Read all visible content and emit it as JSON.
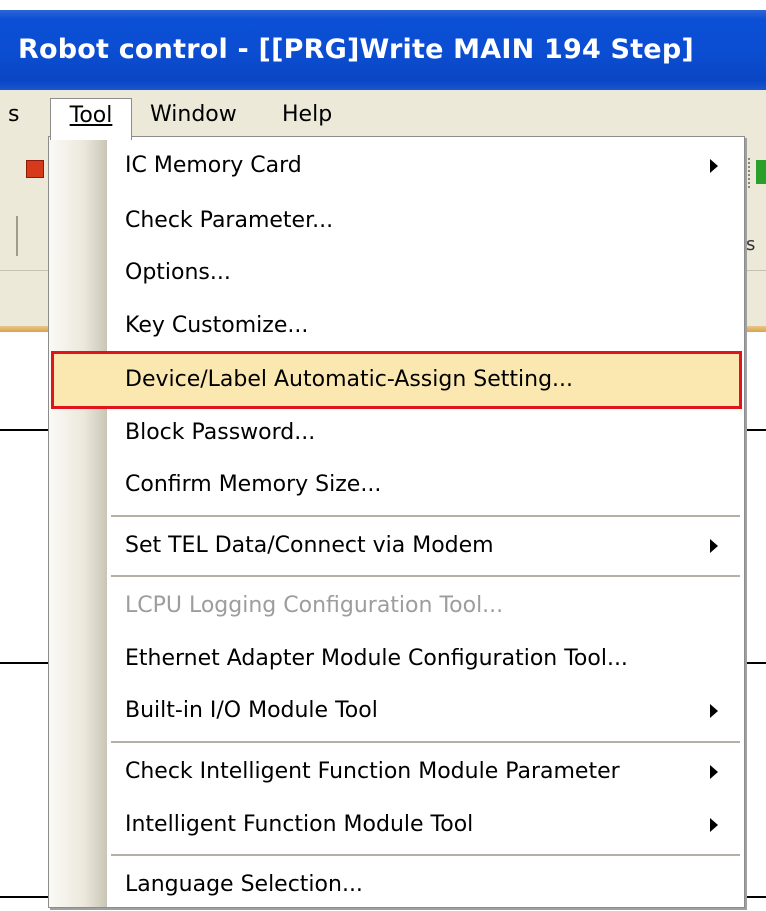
{
  "window": {
    "title": "Robot control - [[PRG]Write MAIN 194 Step]"
  },
  "menubar": {
    "items": [
      {
        "label": "s"
      },
      {
        "label": "Tool"
      },
      {
        "label": "Window"
      },
      {
        "label": "Help"
      }
    ]
  },
  "tool_menu": {
    "items": [
      {
        "label": "IC Memory Card",
        "submenu": true
      },
      {
        "label": "Check Parameter..."
      },
      {
        "label": "Options..."
      },
      {
        "label": "Key Customize..."
      },
      {
        "label": "Device/Label Automatic-Assign Setting...",
        "highlighted": true
      },
      {
        "label": "Block Password..."
      },
      {
        "label": "Confirm Memory Size..."
      },
      {
        "label": "Set TEL Data/Connect via Modem",
        "submenu": true
      },
      {
        "label": "LCPU Logging Configuration Tool...",
        "disabled": true
      },
      {
        "label": "Ethernet Adapter Module Configuration Tool..."
      },
      {
        "label": "Built-in I/O Module Tool",
        "submenu": true
      },
      {
        "label": "Check Intelligent Function Module Parameter",
        "submenu": true
      },
      {
        "label": "Intelligent Function Module Tool",
        "submenu": true
      },
      {
        "label": "Language Selection..."
      }
    ]
  },
  "background": {
    "partial_text": "s"
  },
  "colors": {
    "highlight_fill": "#fbe8b0",
    "highlight_border": "#e0141c",
    "titlebar": "#0b4ed2"
  }
}
